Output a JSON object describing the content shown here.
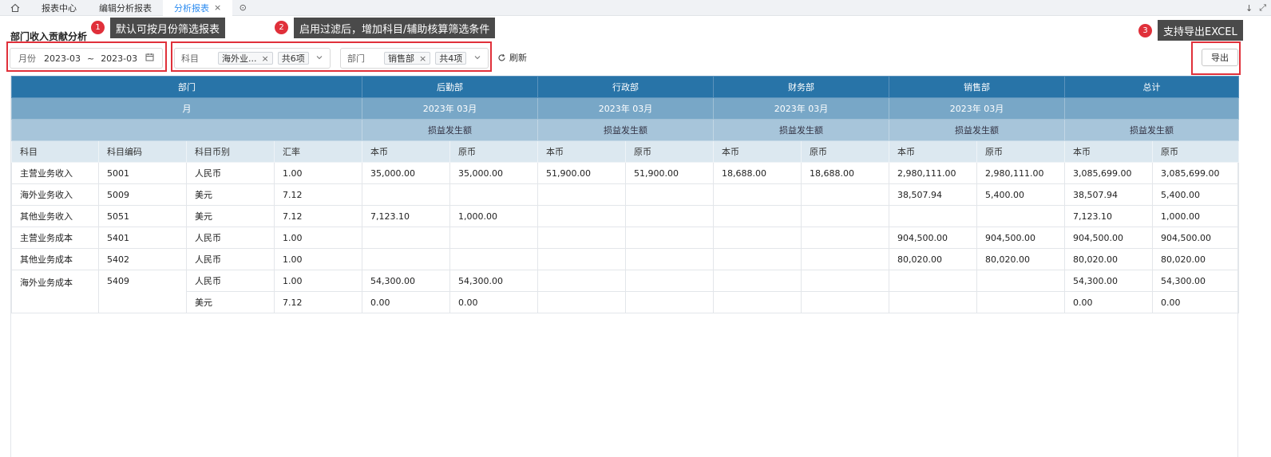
{
  "tabs": {
    "home_icon": "home-icon",
    "items": [
      {
        "label": "报表中心"
      },
      {
        "label": "编辑分析报表"
      },
      {
        "label": "分析报表",
        "close": "×"
      }
    ],
    "more_icon": "⊙",
    "right_icons": [
      "↓",
      "⤢"
    ]
  },
  "page": {
    "title": "部门收入贡献分析"
  },
  "filters": {
    "month": {
      "label": "月份",
      "from": "2023-03",
      "sep": "~",
      "to": "2023-03",
      "icon": "calendar-icon"
    },
    "subject": {
      "label": "科目",
      "chip": "海外业...",
      "count": "共6项"
    },
    "dept": {
      "label": "部门",
      "chip": "销售部",
      "count": "共4项"
    },
    "refresh_label": "刷新",
    "export_label": "导出"
  },
  "annotations": [
    {
      "num": "1",
      "text": "默认可按月份筛选报表"
    },
    {
      "num": "2",
      "text": "启用过滤后，增加科目/辅助核算筛选条件"
    },
    {
      "num": "3",
      "text": "支持导出EXCEL"
    }
  ],
  "colors": {
    "header_dark": "#2874a8",
    "header_mid": "#78a7c7",
    "header_light": "#a7c5da",
    "header_sub": "#dce8f0",
    "annotation_red": "#e0303a",
    "tab_active": "#2d8cf0"
  },
  "table": {
    "row1": {
      "dept_label": "部门",
      "groups": [
        "后勤部",
        "行政部",
        "财务部",
        "销售部",
        "总计"
      ]
    },
    "row2": {
      "month_label": "月",
      "months": [
        "2023年 03月",
        "2023年 03月",
        "2023年 03月",
        "2023年 03月",
        ""
      ]
    },
    "row3": {
      "measures": [
        "损益发生额",
        "损益发生额",
        "损益发生额",
        "损益发生额",
        "损益发生额"
      ]
    },
    "columns": [
      "科目",
      "科目编码",
      "科目币别",
      "汇率",
      "本币",
      "原币",
      "本币",
      "原币",
      "本币",
      "原币",
      "本币",
      "原币",
      "本币",
      "原币"
    ],
    "rows": [
      [
        "主营业务收入",
        "5001",
        "人民币",
        "1.00",
        "35,000.00",
        "35,000.00",
        "51,900.00",
        "51,900.00",
        "18,688.00",
        "18,688.00",
        "2,980,111.00",
        "2,980,111.00",
        "3,085,699.00",
        "3,085,699.00"
      ],
      [
        "海外业务收入",
        "5009",
        "美元",
        "7.12",
        "",
        "",
        "",
        "",
        "",
        "",
        "38,507.94",
        "5,400.00",
        "38,507.94",
        "5,400.00"
      ],
      [
        "其他业务收入",
        "5051",
        "美元",
        "7.12",
        "7,123.10",
        "1,000.00",
        "",
        "",
        "",
        "",
        "",
        "",
        "7,123.10",
        "1,000.00"
      ],
      [
        "主营业务成本",
        "5401",
        "人民币",
        "1.00",
        "",
        "",
        "",
        "",
        "",
        "",
        "904,500.00",
        "904,500.00",
        "904,500.00",
        "904,500.00"
      ],
      [
        "其他业务成本",
        "5402",
        "人民币",
        "1.00",
        "",
        "",
        "",
        "",
        "",
        "",
        "80,020.00",
        "80,020.00",
        "80,020.00",
        "80,020.00"
      ]
    ],
    "merged_row": {
      "subject": "海外业务成本",
      "code": "5409",
      "sub_rows": [
        [
          "人民币",
          "1.00",
          "54,300.00",
          "54,300.00",
          "",
          "",
          "",
          "",
          "",
          "",
          "54,300.00",
          "54,300.00"
        ],
        [
          "美元",
          "7.12",
          "0.00",
          "0.00",
          "",
          "",
          "",
          "",
          "",
          "",
          "0.00",
          "0.00"
        ]
      ]
    }
  }
}
